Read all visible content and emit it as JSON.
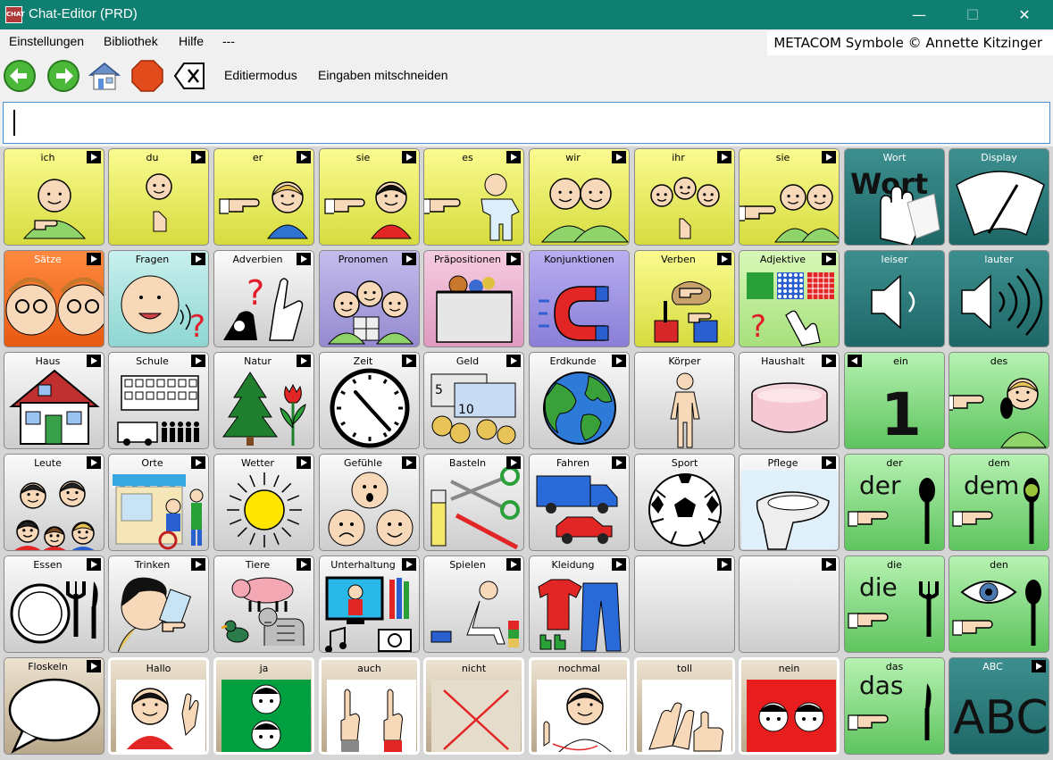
{
  "window": {
    "title": "Chat-Editor (PRD)",
    "app_icon_text": "CHAT",
    "minimize": "—",
    "maximize": "☐",
    "close": "✕"
  },
  "menu": {
    "items": [
      "Einstellungen",
      "Bibliothek",
      "Hilfe",
      "---"
    ],
    "copyright": "METACOM Symbole © Annette Kitzinger"
  },
  "toolbar": {
    "editmode": "Editiermodus",
    "record": "Eingaben mitschneiden"
  },
  "input": {
    "value": ""
  },
  "grid": {
    "rows": [
      [
        {
          "label": "ich",
          "style": "yellow",
          "arrow": "right",
          "icon": "person-self-icon"
        },
        {
          "label": "du",
          "style": "yellow",
          "arrow": "right",
          "icon": "person-you-icon"
        },
        {
          "label": "er",
          "style": "yellow",
          "arrow": "right",
          "icon": "person-he-icon"
        },
        {
          "label": "sie",
          "style": "yellow",
          "arrow": "right",
          "icon": "person-she-icon"
        },
        {
          "label": "es",
          "style": "yellow",
          "arrow": "right",
          "icon": "baby-icon"
        },
        {
          "label": "wir",
          "style": "yellow",
          "arrow": "right",
          "icon": "people-we-icon"
        },
        {
          "label": "ihr",
          "style": "yellow",
          "arrow": "right",
          "icon": "people-you-plural-icon"
        },
        {
          "label": "sie",
          "style": "yellow",
          "arrow": "right",
          "icon": "people-they-icon"
        },
        {
          "label": "Wort",
          "style": "teal",
          "arrow": "",
          "icon": "erase-word-icon"
        },
        {
          "label": "Display",
          "style": "teal",
          "arrow": "",
          "icon": "wiper-icon"
        }
      ],
      [
        {
          "label": "Sätze",
          "style": "orange",
          "arrow": "right",
          "icon": "faces-talking-icon"
        },
        {
          "label": "Fragen",
          "style": "cyan",
          "arrow": "right",
          "icon": "question-face-icon"
        },
        {
          "label": "Adverbien",
          "style": "gray",
          "arrow": "right",
          "icon": "question-hands-icon"
        },
        {
          "label": "Pronomen",
          "style": "lavender",
          "arrow": "right",
          "icon": "group-pronouns-icon"
        },
        {
          "label": "Präpositionen",
          "style": "pink",
          "arrow": "right",
          "icon": "box-teddy-icon"
        },
        {
          "label": "Konjunktionen",
          "style": "violet",
          "arrow": "",
          "icon": "magnet-icon"
        },
        {
          "label": "Verben",
          "style": "yellow",
          "arrow": "right",
          "icon": "action-hands-icon"
        },
        {
          "label": "Adjektive",
          "style": "lightgreen",
          "arrow": "right",
          "icon": "patterns-icon"
        },
        {
          "label": "leiser",
          "style": "teal",
          "arrow": "",
          "icon": "volume-down-icon"
        },
        {
          "label": "lauter",
          "style": "teal",
          "arrow": "",
          "icon": "volume-up-icon"
        }
      ],
      [
        {
          "label": "Haus",
          "style": "gray",
          "arrow": "right",
          "icon": "house-icon"
        },
        {
          "label": "Schule",
          "style": "gray",
          "arrow": "right",
          "icon": "school-icon"
        },
        {
          "label": "Natur",
          "style": "gray",
          "arrow": "right",
          "icon": "tree-flower-icon"
        },
        {
          "label": "Zeit",
          "style": "gray",
          "arrow": "right",
          "icon": "clock-icon"
        },
        {
          "label": "Geld",
          "style": "gray",
          "arrow": "right",
          "icon": "money-icon"
        },
        {
          "label": "Erdkunde",
          "style": "gray",
          "arrow": "right",
          "icon": "globe-icon"
        },
        {
          "label": "Körper",
          "style": "gray",
          "arrow": "",
          "icon": "body-icon"
        },
        {
          "label": "Haushalt",
          "style": "gray",
          "arrow": "right",
          "icon": "bowl-icon"
        },
        {
          "label": "ein",
          "style": "green",
          "arrow": "left",
          "icon": "number-one-icon"
        },
        {
          "label": "des",
          "style": "green",
          "arrow": "",
          "icon": "pointing-boy-icon"
        }
      ],
      [
        {
          "label": "Leute",
          "style": "gray",
          "arrow": "right",
          "icon": "family-icon"
        },
        {
          "label": "Orte",
          "style": "gray",
          "arrow": "right",
          "icon": "shop-icon"
        },
        {
          "label": "Wetter",
          "style": "gray",
          "arrow": "right",
          "icon": "sun-icon"
        },
        {
          "label": "Gefühle",
          "style": "gray",
          "arrow": "right",
          "icon": "feelings-icon"
        },
        {
          "label": "Basteln",
          "style": "gray",
          "arrow": "right",
          "icon": "scissors-icon"
        },
        {
          "label": "Fahren",
          "style": "gray",
          "arrow": "right",
          "icon": "vehicles-icon"
        },
        {
          "label": "Sport",
          "style": "gray",
          "arrow": "",
          "icon": "soccer-ball-icon"
        },
        {
          "label": "Pflege",
          "style": "gray",
          "arrow": "right",
          "icon": "toilet-icon"
        },
        {
          "label": "der",
          "style": "green",
          "arrow": "",
          "icon": "pointing-spoon-icon"
        },
        {
          "label": "dem",
          "style": "green",
          "arrow": "",
          "icon": "pointing-spoon-dot-icon"
        }
      ],
      [
        {
          "label": "Essen",
          "style": "gray",
          "arrow": "right",
          "icon": "plate-cutlery-icon"
        },
        {
          "label": "Trinken",
          "style": "gray",
          "arrow": "right",
          "icon": "drinking-icon"
        },
        {
          "label": "Tiere",
          "style": "gray",
          "arrow": "right",
          "icon": "animals-icon"
        },
        {
          "label": "Unterhaltung",
          "style": "gray",
          "arrow": "right",
          "icon": "tv-music-icon"
        },
        {
          "label": "Spielen",
          "style": "gray",
          "arrow": "right",
          "icon": "playing-child-icon"
        },
        {
          "label": "Kleidung",
          "style": "gray",
          "arrow": "right",
          "icon": "clothes-icon"
        },
        {
          "label": "",
          "style": "gray",
          "arrow": "right",
          "icon": ""
        },
        {
          "label": "",
          "style": "gray",
          "arrow": "right",
          "icon": ""
        },
        {
          "label": "die",
          "style": "green",
          "arrow": "",
          "icon": "pointing-fork-icon"
        },
        {
          "label": "den",
          "style": "green",
          "arrow": "",
          "icon": "pointing-eye-icon"
        }
      ],
      [
        {
          "label": "Floskeln",
          "style": "tan",
          "arrow": "right",
          "icon": "speech-bubble-icon"
        },
        {
          "label": "Hallo",
          "style": "tanwhite",
          "arrow": "",
          "icon": "waving-girl-icon"
        },
        {
          "label": "ja",
          "style": "tanwhite",
          "arrow": "",
          "icon": "yes-faces-icon"
        },
        {
          "label": "auch",
          "style": "tanwhite",
          "arrow": "",
          "icon": "fingers-up-icon"
        },
        {
          "label": "nicht",
          "style": "tanwhite",
          "arrow": "",
          "icon": "red-cross-icon"
        },
        {
          "label": "nochmal",
          "style": "tanwhite",
          "arrow": "",
          "icon": "again-girl-icon"
        },
        {
          "label": "toll",
          "style": "tanwhite",
          "arrow": "",
          "icon": "clapping-icon"
        },
        {
          "label": "nein",
          "style": "tanwhite",
          "arrow": "",
          "icon": "no-faces-icon"
        },
        {
          "label": "das",
          "style": "green",
          "arrow": "",
          "icon": "pointing-knife-icon"
        },
        {
          "label": "ABC",
          "style": "teal",
          "arrow": "right",
          "icon": "abc-keyboard-icon"
        }
      ]
    ],
    "text_in_icons": {
      "wort": "Wort",
      "der": "der",
      "dem": "dem",
      "die": "die",
      "den": "den",
      "das": "das",
      "abc": "ABC",
      "one": "1"
    }
  }
}
